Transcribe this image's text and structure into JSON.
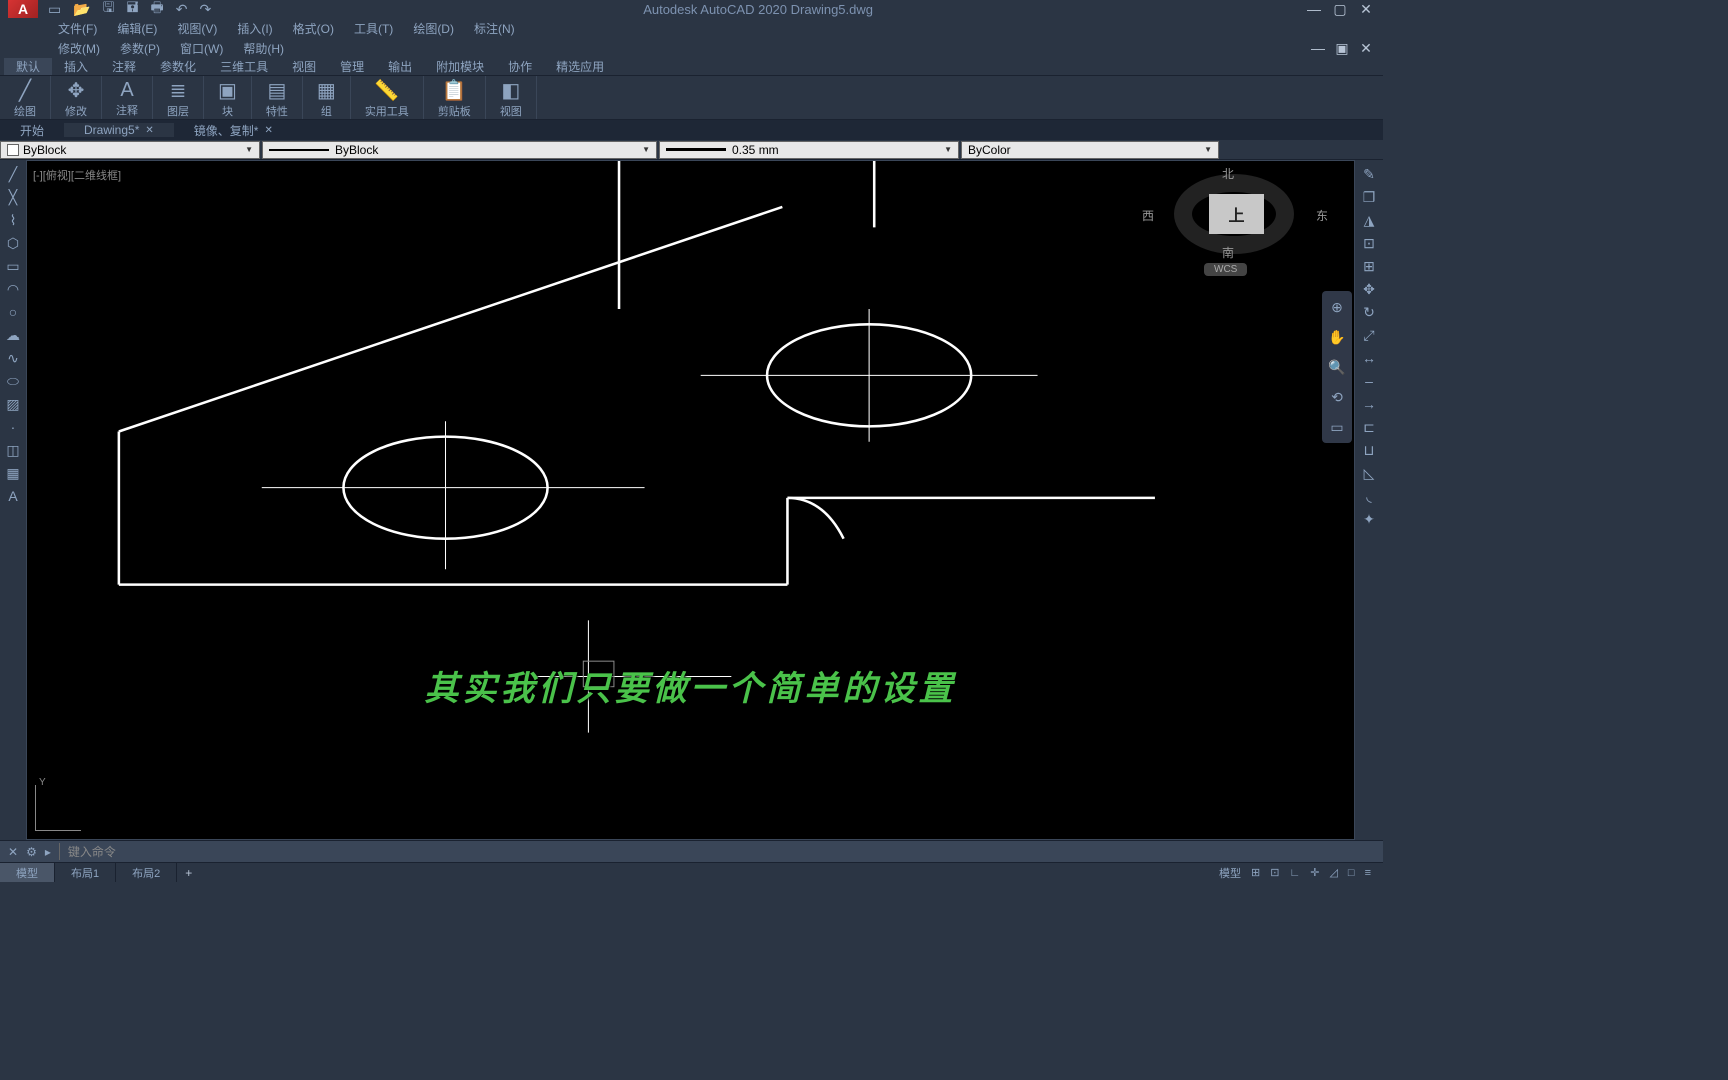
{
  "title": "Autodesk AutoCAD 2020   Drawing5.dwg",
  "logo": "A",
  "menus1": [
    "文件(F)",
    "编辑(E)",
    "视图(V)",
    "插入(I)",
    "格式(O)",
    "工具(T)",
    "绘图(D)",
    "标注(N)"
  ],
  "menus2": [
    "修改(M)",
    "参数(P)",
    "窗口(W)",
    "帮助(H)"
  ],
  "ribbon_tabs": [
    "默认",
    "插入",
    "注释",
    "参数化",
    "三维工具",
    "视图",
    "管理",
    "输出",
    "附加模块",
    "协作",
    "精选应用"
  ],
  "ribbon_panels": [
    {
      "label": "绘图"
    },
    {
      "label": "修改"
    },
    {
      "label": "注释"
    },
    {
      "label": "图层"
    },
    {
      "label": "块"
    },
    {
      "label": "特性"
    },
    {
      "label": "组"
    },
    {
      "label": "实用工具"
    },
    {
      "label": "剪贴板"
    },
    {
      "label": "视图"
    }
  ],
  "doc_tabs": {
    "start": "开始",
    "active": "Drawing5*",
    "context": "镜像、复制*"
  },
  "props": {
    "color": "ByBlock",
    "linetype": "ByBlock",
    "lineweight": "0.35 mm",
    "plotstyle": "ByColor"
  },
  "view_label": "[-][俯视][二维线框]",
  "viewcube": {
    "top": "上",
    "n": "北",
    "s": "南",
    "e": "东",
    "w": "西",
    "wcs": "WCS"
  },
  "subtitle": "其实我们只要做一个简单的设置",
  "cmd_placeholder": "键入命令",
  "layout_tabs": {
    "model": "模型",
    "layout1": "布局1",
    "layout2": "布局2"
  },
  "status": {
    "model_btn": "模型"
  },
  "ucs": {
    "y": "Y"
  }
}
